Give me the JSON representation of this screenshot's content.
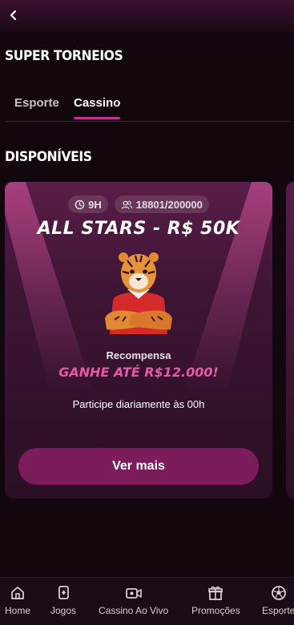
{
  "header": {
    "back_icon": "chevron-left-icon"
  },
  "page_title": "SUPER TORNEIOS",
  "tabs": [
    {
      "label": "Esporte",
      "active": false
    },
    {
      "label": "Cassino",
      "active": true
    }
  ],
  "section_title": "DISPONÍVEIS",
  "card": {
    "duration": "9H",
    "participants": "18801/200000",
    "title": "ALL STARS - R$ 50K",
    "reward_label": "Recompensa",
    "reward_value": "GANHE ATÉ R$12.000!",
    "schedule": "Participe diariamente às 00h",
    "cta_label": "Ver mais"
  },
  "bottom_nav": [
    {
      "label": "Home",
      "icon": "home-icon"
    },
    {
      "label": "Jogos",
      "icon": "cards-icon"
    },
    {
      "label": "Cassino Ao Vivo",
      "icon": "live-video-icon"
    },
    {
      "label": "Promoções",
      "icon": "gift-icon"
    },
    {
      "label": "Esporte",
      "icon": "soccer-ball-icon"
    }
  ],
  "colors": {
    "accent": "#c7358a",
    "button": "#7c1c5a",
    "reward": "#e45aa5",
    "background": "#12070f"
  }
}
